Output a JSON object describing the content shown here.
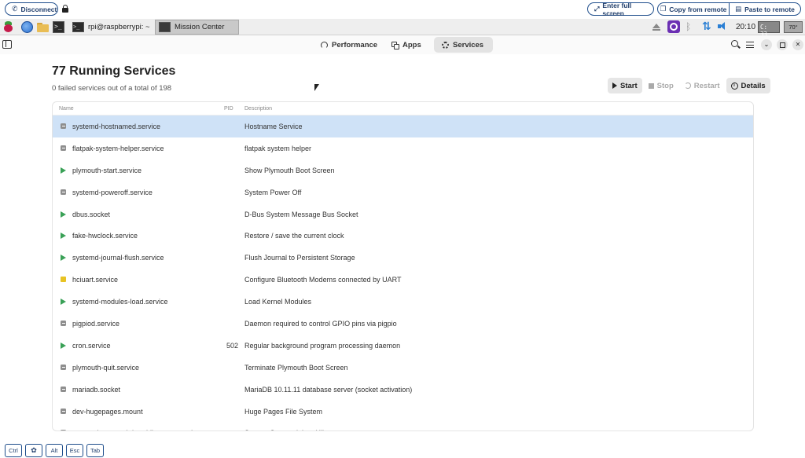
{
  "remote": {
    "disconnect_label": "Disconnect",
    "fullscreen_label": "Enter full screen",
    "copy_label": "Copy from remote",
    "paste_label": "Paste to remote"
  },
  "taskbar": {
    "terminal_task": "rpi@raspberrypi: ~",
    "app_task": "Mission Center",
    "clock": "20:10",
    "cpu_label": "C: 33",
    "temp_label": "70°"
  },
  "tabs": [
    {
      "label": "Performance"
    },
    {
      "label": "Apps"
    },
    {
      "label": "Services"
    }
  ],
  "page": {
    "title": "77 Running Services",
    "subtitle": "0 failed services out of a total of 198"
  },
  "actions": {
    "start": "Start",
    "stop": "Stop",
    "restart": "Restart",
    "details": "Details"
  },
  "columns": {
    "name": "Name",
    "pid": "PID",
    "description": "Description"
  },
  "services": [
    {
      "status": "stopped",
      "name": "systemd-hostnamed.service",
      "pid": "",
      "description": "Hostname Service"
    },
    {
      "status": "stopped",
      "name": "flatpak-system-helper.service",
      "pid": "",
      "description": "flatpak system helper"
    },
    {
      "status": "running",
      "name": "plymouth-start.service",
      "pid": "",
      "description": "Show Plymouth Boot Screen"
    },
    {
      "status": "stopped",
      "name": "systemd-poweroff.service",
      "pid": "",
      "description": "System Power Off"
    },
    {
      "status": "running",
      "name": "dbus.socket",
      "pid": "",
      "description": "D-Bus System Message Bus Socket"
    },
    {
      "status": "running",
      "name": "fake-hwclock.service",
      "pid": "",
      "description": "Restore / save the current clock"
    },
    {
      "status": "running",
      "name": "systemd-journal-flush.service",
      "pid": "",
      "description": "Flush Journal to Persistent Storage"
    },
    {
      "status": "failed",
      "name": "hciuart.service",
      "pid": "",
      "description": "Configure Bluetooth Modems connected by UART"
    },
    {
      "status": "running",
      "name": "systemd-modules-load.service",
      "pid": "",
      "description": "Load Kernel Modules"
    },
    {
      "status": "stopped",
      "name": "pigpiod.service",
      "pid": "",
      "description": "Daemon required to control GPIO pins via pigpio"
    },
    {
      "status": "running",
      "name": "cron.service",
      "pid": "502",
      "description": "Regular background program processing daemon"
    },
    {
      "status": "stopped",
      "name": "plymouth-quit.service",
      "pid": "",
      "description": "Terminate Plymouth Boot Screen"
    },
    {
      "status": "stopped",
      "name": "mariadb.socket",
      "pid": "",
      "description": "MariaDB 10.11.11 database server (socket activation)"
    },
    {
      "status": "stopped",
      "name": "dev-hugepages.mount",
      "pid": "",
      "description": "Huge Pages File System"
    },
    {
      "status": "stopped",
      "name": "systemd-suspend-then-hibernate.service",
      "pid": "",
      "description": "System Suspend then Hibernate"
    }
  ],
  "keys": [
    {
      "label": "Ctrl"
    },
    {
      "label": ""
    },
    {
      "label": "Alt"
    },
    {
      "label": "Esc"
    },
    {
      "label": "Tab"
    }
  ],
  "colors": {
    "selected_row": "#cfe2f7",
    "running": "#3aa157",
    "stopped": "#8e8e8e",
    "failed": "#e8c323",
    "remote_accent": "#1f4e8c"
  }
}
